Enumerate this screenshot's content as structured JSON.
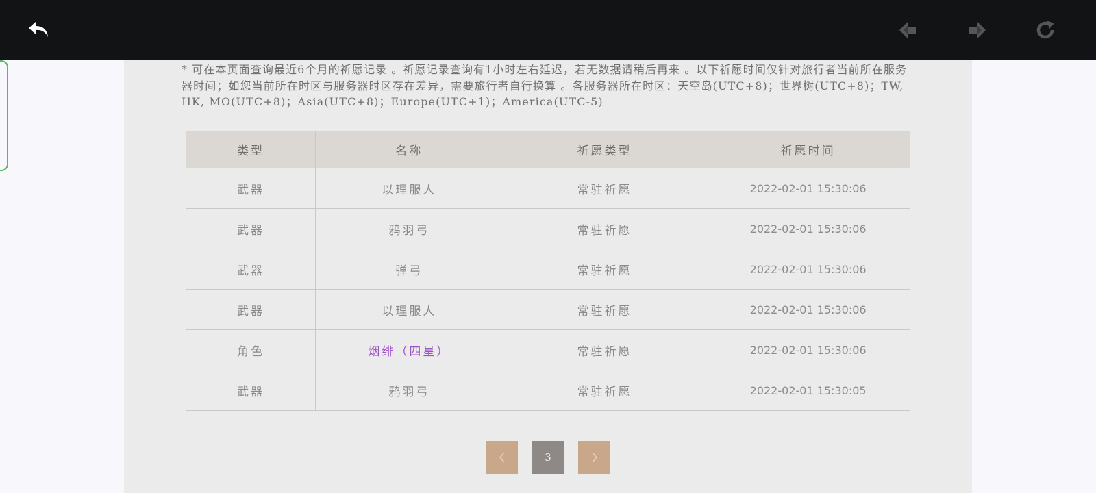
{
  "notice": "* 可在本页面查询最近6个月的祈愿记录 。祈愿记录查询有1小时左右延迟，若无数据请稍后再来 。以下祈愿时间仅针对旅行者当前所在服务器时间；如您当前所在时区与服务器时区存在差异，需要旅行者自行换算 。各服务器所在时区：天空岛(UTC+8)；世界树(UTC+8)；TW, HK, MO(UTC+8)；Asia(UTC+8)；Europe(UTC+1)；America(UTC-5)",
  "table": {
    "headers": [
      "类型",
      "名称",
      "祈愿类型",
      "祈愿时间"
    ],
    "rows": [
      {
        "type": "武器",
        "name": "以理服人",
        "wish": "常驻祈愿",
        "time": "2022-02-01 15:30:06"
      },
      {
        "type": "武器",
        "name": "鸦羽弓",
        "wish": "常驻祈愿",
        "time": "2022-02-01 15:30:06"
      },
      {
        "type": "武器",
        "name": "弹弓",
        "wish": "常驻祈愿",
        "time": "2022-02-01 15:30:06"
      },
      {
        "type": "武器",
        "name": "以理服人",
        "wish": "常驻祈愿",
        "time": "2022-02-01 15:30:06"
      },
      {
        "type": "角色",
        "name": "烟绯（四星）",
        "wish": "常驻祈愿",
        "time": "2022-02-01 15:30:06"
      },
      {
        "type": "武器",
        "name": "鸦羽弓",
        "wish": "常驻祈愿",
        "time": "2022-02-01 15:30:05"
      }
    ]
  },
  "pagination": {
    "current_page": "3"
  },
  "colors": {
    "topbar": "#121315",
    "header_bg": "#dbd8d3",
    "four_star": "#9d52c8",
    "pager_arrow": "#c8a78b",
    "pager_current": "#8e8987"
  },
  "icons": {
    "back": "back-arrow-icon",
    "prev": "nav-back-icon",
    "next": "nav-forward-icon",
    "reload": "reload-icon",
    "pager_prev": "chevron-left-icon",
    "pager_next": "chevron-right-icon"
  }
}
